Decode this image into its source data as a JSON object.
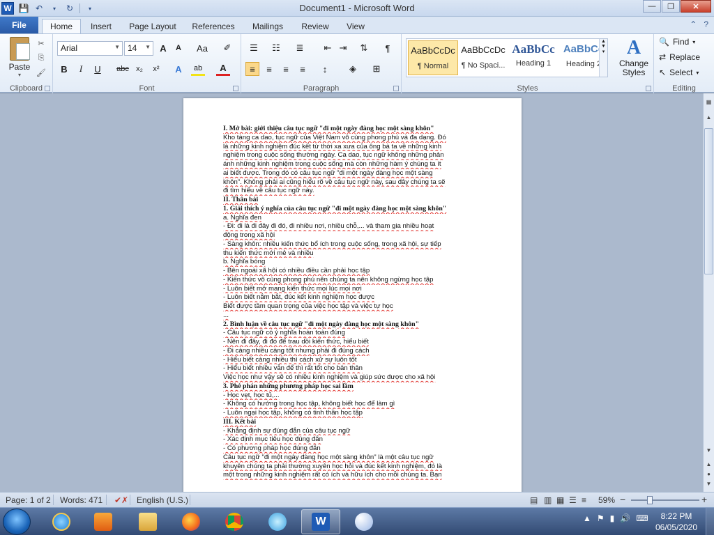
{
  "window": {
    "title": "Document1  -  Microsoft Word",
    "controls": {
      "minimize": "—",
      "restore": "❐",
      "close": "✕"
    }
  },
  "tabs": {
    "file": "File",
    "items": [
      "Home",
      "Insert",
      "Page Layout",
      "References",
      "Mailings",
      "Review",
      "View"
    ],
    "active": "Home"
  },
  "ribbon": {
    "clipboard": {
      "paste": "Paste",
      "label": "Clipboard"
    },
    "font": {
      "name": "Arial",
      "size": "14",
      "label": "Font",
      "grow": "A",
      "shrink": "A",
      "case": "Aa",
      "bold": "B",
      "italic": "I",
      "underline": "U",
      "strike": "abc",
      "sub": "x₂",
      "sup": "x²",
      "effects": "A",
      "highlight": "ab",
      "color": "A"
    },
    "paragraph": {
      "label": "Paragraph",
      "show_marks": "¶"
    },
    "styles": {
      "label": "Styles",
      "items": [
        {
          "sample": "AaBbCcDc",
          "name": "¶ Normal"
        },
        {
          "sample": "AaBbCcDc",
          "name": "¶ No Spaci..."
        },
        {
          "sample": "AaBbCc",
          "name": "Heading 1"
        },
        {
          "sample": "AaBbCc",
          "name": "Heading 2"
        }
      ],
      "change_styles": "Change Styles"
    },
    "editing": {
      "label": "Editing",
      "find": "Find",
      "replace": "Replace",
      "select": "Select"
    }
  },
  "document": {
    "lines": [
      {
        "t": "I. Mở bài: giới thiệu câu tục ngữ \"đi một ngày đàng học một sàng khôn\"",
        "h": true
      },
      {
        "t": "Kho tàng ca dao, tục ngữ của Việt Nam vô cùng phong phú và đa dạng. Đó"
      },
      {
        "t": "là những kinh nghiệm đúc kết từ thời xa xưa của ông bà ta về những kinh"
      },
      {
        "t": "nghiệm trong cuộc sống thường ngày. Ca dao, tục ngữ không những phản"
      },
      {
        "t": "ánh những kinh nghiệm trong cuộc sống mà còn những hàm ý chúng ta ít"
      },
      {
        "t": "ai biết được. Trong đó có câu tục ngữ \"đi một ngày đàng học một sàng"
      },
      {
        "t": "khôn\". Không phải ai cũng hiểu rõ về câu tục ngữ này, sau đây chúng ta sẽ"
      },
      {
        "t": "đi tìm hiểu về câu tục ngữ này."
      },
      {
        "t": "II. Thân bài",
        "h": true
      },
      {
        "t": "1. Giải thích ý nghĩa của câu tục ngữ \"đi một ngày đàng học một sàng khôn\"",
        "h": true
      },
      {
        "t": "a. Nghĩa đen"
      },
      {
        "t": "- Đi: đi là đi đây đi đó, đi nhiều nơi, nhiều chỗ,... và tham gia nhiều hoạt"
      },
      {
        "t": "động trong xã hội"
      },
      {
        "t": "- Sàng khôn: nhiều kiến thức bổ ích trong cuộc sống, trong xã hội, sự tiếp"
      },
      {
        "t": "thu kiến thức mới mẻ và nhiều"
      },
      {
        "t": "b. Nghĩa bóng"
      },
      {
        "t": "- Bên ngoài xã hội có nhiều điều cần phải học tập"
      },
      {
        "t": "- Kiến thức vô cùng phong phú nên chúng ta nên không ngừng học tập"
      },
      {
        "t": "- Luôn biết mở mang kiến thức mọi lúc mọi nơi"
      },
      {
        "t": "- Luôn biết nắm bắt, đúc kết kinh nghiệm học được"
      },
      {
        "t": "Biết được tầm quan trọng của việc học tập và việc tự học"
      },
      {
        "t": "..."
      },
      {
        "t": "2. Bình luận về câu tục ngữ \"đi một ngày đàng học một sàng khôn\"",
        "h": true
      },
      {
        "t": "- Câu tục ngữ có ý nghĩa hoàn toàn đúng"
      },
      {
        "t": "- Nên đi đây, đi đó để trau dồi kiến thức, hiểu biết"
      },
      {
        "t": "- Đi càng nhiều càng tốt nhưng phải đi đúng cách"
      },
      {
        "t": "- Hiểu biết càng nhiều thì cách xử sự luôn tốt"
      },
      {
        "t": "- Hiểu biết nhiều vẫn để thì rất tốt cho bản thân"
      },
      {
        "t": "Việc học như vậy sẽ có nhiều kinh nghiệm và giúp sức được cho xã hội"
      },
      {
        "t": "3. Phê phán những phương pháp học sai lầm",
        "h": true
      },
      {
        "t": "- Học vẹt, học tủ,..."
      },
      {
        "t": "- Không có hướng trong học tập, không biết học để làm gì"
      },
      {
        "t": "- Luôn ngại học tập, không có tinh thần học tập"
      },
      {
        "t": "III. Kết bài",
        "h": true
      },
      {
        "t": "- Khẳng định sự đúng đắn của câu tục ngữ"
      },
      {
        "t": "- Xác định mục tiêu học đúng đắn"
      },
      {
        "t": "- Có phương pháp học đúng đắn"
      },
      {
        "t": "Câu tục ngữ \"đi một ngày đàng học một sàng khôn\" là một câu tục ngữ"
      },
      {
        "t": "khuyên chúng ta phải thường xuyên học hỏi và đúc kết kinh nghiệm, đó là"
      },
      {
        "t": "một trong những kinh nghiệm rất có ích và hữu ích cho mỗi chúng ta. Bạn"
      }
    ]
  },
  "status": {
    "page": "Page: 1 of 2",
    "words": "Words: 471",
    "language": "English (U.S.)",
    "zoom": "59%",
    "zoom_minus": "−",
    "zoom_plus": "+"
  },
  "taskbar": {
    "apps": [
      "Internet Explorer",
      "Windows Media Player",
      "File Explorer",
      "Firefox",
      "Chrome",
      "Cốc Cốc",
      "Microsoft Word",
      "Paint"
    ],
    "time": "8:22 PM",
    "date": "06/05/2020"
  },
  "colors": {
    "accent": "#2a5aa6",
    "spell_underline": "#e0302b"
  }
}
